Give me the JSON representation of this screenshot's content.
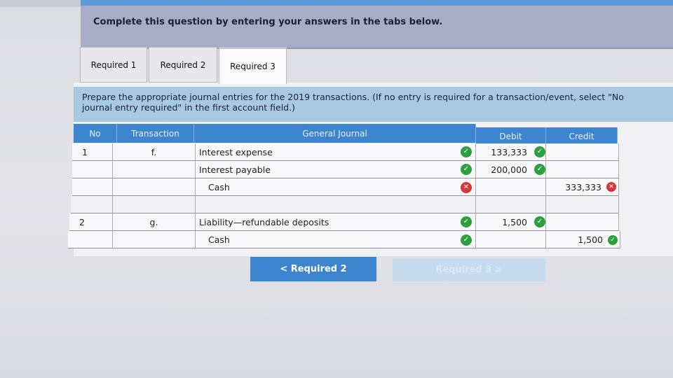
{
  "banner": {
    "text": "Complete this question by entering your answers in the tabs below."
  },
  "tabs": [
    {
      "label": "Required 1"
    },
    {
      "label": "Required 2"
    },
    {
      "label": "Required 3"
    }
  ],
  "instruction": {
    "line1": "Prepare the appropriate journal entries for the 2019 transactions. (If no entry is required for a transaction/event, select \"No",
    "line2": "journal entry required\" in the first account field.)"
  },
  "table": {
    "headers": {
      "no": "No",
      "transaction": "Transaction",
      "general_journal": "General Journal",
      "debit": "Debit",
      "credit": "Credit"
    },
    "rows": [
      {
        "no": "1",
        "transaction": "f.",
        "account": "Interest expense",
        "debit": "133,333",
        "credit": ""
      },
      {
        "no": "",
        "transaction": "",
        "account": "Interest payable",
        "debit": "200,000",
        "credit": ""
      },
      {
        "no": "",
        "transaction": "",
        "account": "Cash",
        "debit": "",
        "credit": "333,333"
      },
      {
        "no": "",
        "transaction": "",
        "account": "",
        "debit": "",
        "credit": ""
      },
      {
        "no": "2",
        "transaction": "g.",
        "account": "Liability—refundable deposits",
        "debit": "1,500",
        "credit": ""
      },
      {
        "no": "",
        "transaction": "",
        "account": "Cash",
        "debit": "",
        "credit": "1,500"
      }
    ]
  },
  "nav": {
    "prev_label": "< Required 2",
    "next_label": "Required 3 >"
  },
  "colors": {
    "accent": "#3d86cf",
    "ok": "#2e9f3e",
    "error": "#d6353a"
  }
}
